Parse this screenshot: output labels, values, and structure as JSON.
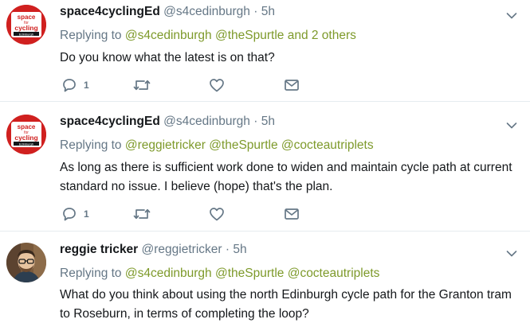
{
  "tweets": [
    {
      "name": "space4cyclingEd",
      "handle": "@s4cedinburgh",
      "separator": "·",
      "time": "5h",
      "replying_prefix": "Replying to",
      "replying_mentions": [
        "@s4cedinburgh",
        "@theSpurtle"
      ],
      "replying_suffix": "and 2 others",
      "text": "Do you know what the latest is on that?",
      "reply_count": "1",
      "avatar_text": [
        "space",
        "for",
        "cycling",
        "Edinburgh"
      ]
    },
    {
      "name": "space4cyclingEd",
      "handle": "@s4cedinburgh",
      "separator": "·",
      "time": "5h",
      "replying_prefix": "Replying to",
      "replying_mentions": [
        "@reggietricker",
        "@theSpurtle",
        "@cocteautriplets"
      ],
      "text": "As long as there is sufficient work done to widen and maintain cycle path at current standard no issue. I believe (hope) that's the plan.",
      "reply_count": "1",
      "avatar_text": [
        "space",
        "for",
        "cycling",
        "Edinburgh"
      ]
    },
    {
      "name": "reggie tricker",
      "handle": "@reggietricker",
      "separator": "·",
      "time": "5h",
      "replying_prefix": "Replying to",
      "replying_mentions": [
        "@s4cedinburgh",
        "@theSpurtle",
        "@cocteautriplets"
      ],
      "text": "What do you think about using the north Edinburgh cycle path for the Granton tram to Roseburn, in terms of completing the loop?"
    }
  ],
  "icons": {
    "reply": "reply-icon",
    "retweet": "retweet-icon",
    "like": "heart-icon",
    "dm": "envelope-icon",
    "more": "chevron-down-icon"
  },
  "colors": {
    "link": "#7e9a2b",
    "muted": "#657786",
    "divider": "#e6ecf0",
    "logo_red": "#d0201f"
  }
}
